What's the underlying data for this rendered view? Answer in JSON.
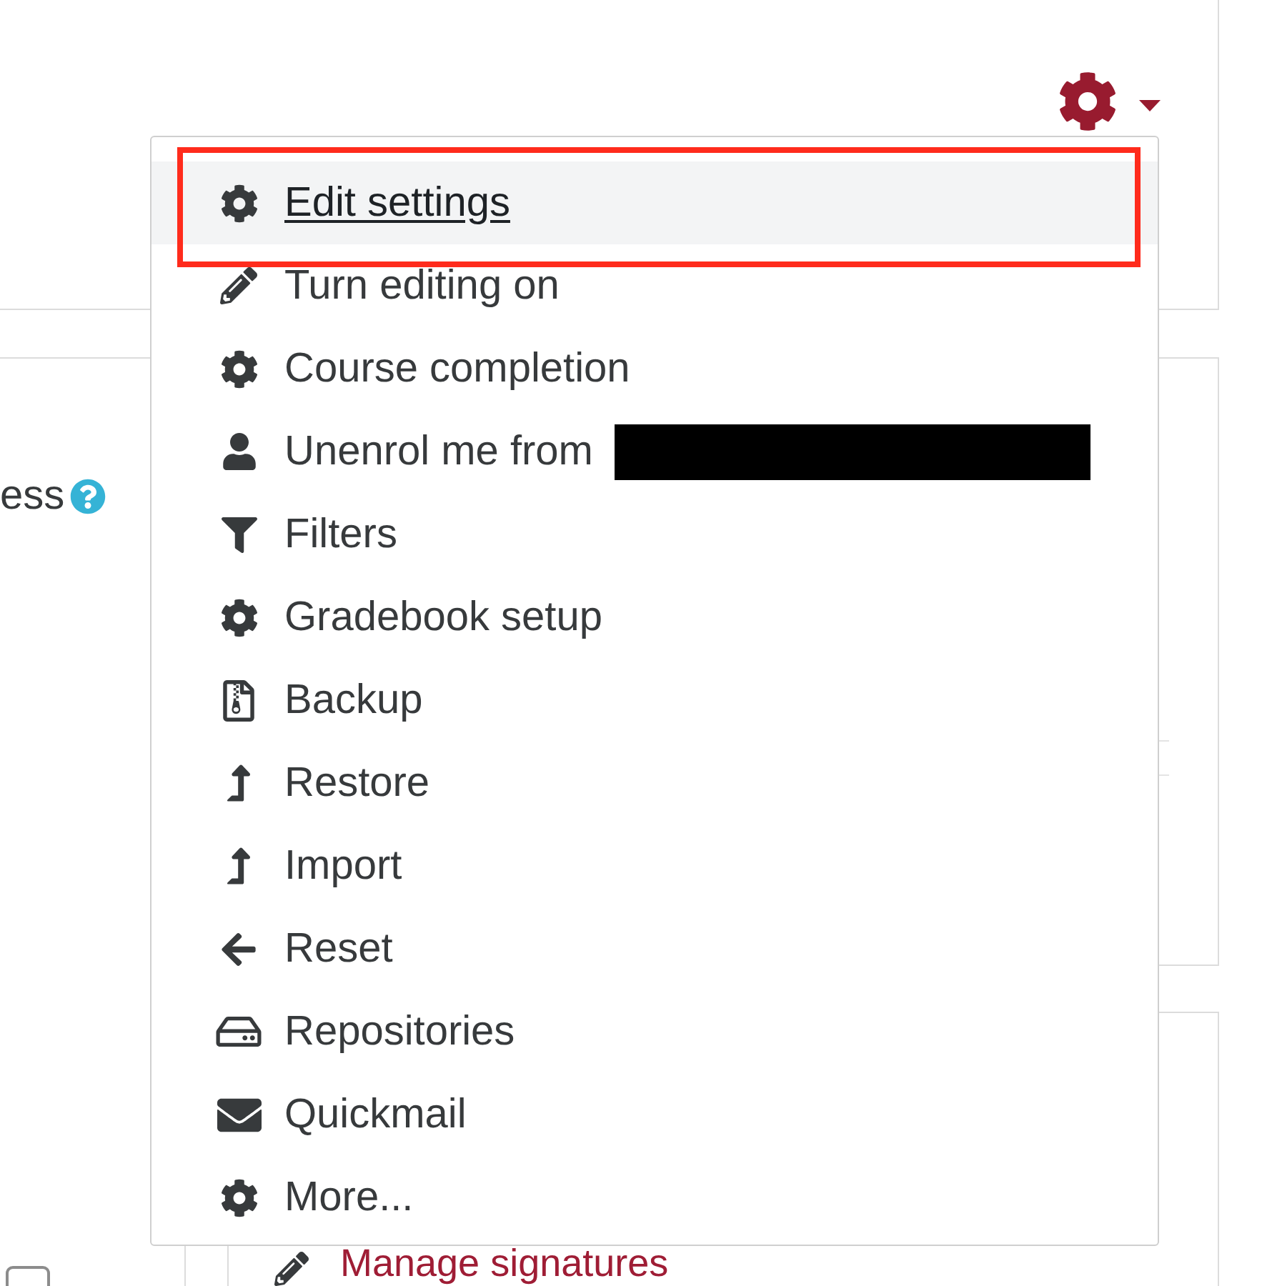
{
  "settings_menu": {
    "expanded": true,
    "items": [
      {
        "label": "Edit settings",
        "selected": true,
        "outlined": true,
        "redacted": false
      },
      {
        "label": "Turn editing on",
        "selected": false,
        "outlined": false,
        "redacted": false
      },
      {
        "label": "Course completion",
        "selected": false,
        "outlined": false,
        "redacted": false
      },
      {
        "label": "Unenrol me from",
        "selected": false,
        "outlined": false,
        "redacted": true
      },
      {
        "label": "Filters",
        "selected": false,
        "outlined": false,
        "redacted": false
      },
      {
        "label": "Gradebook setup",
        "selected": false,
        "outlined": false,
        "redacted": false
      },
      {
        "label": "Backup",
        "selected": false,
        "outlined": false,
        "redacted": false
      },
      {
        "label": "Restore",
        "selected": false,
        "outlined": false,
        "redacted": false
      },
      {
        "label": "Import",
        "selected": false,
        "outlined": false,
        "redacted": false
      },
      {
        "label": "Reset",
        "selected": false,
        "outlined": false,
        "redacted": false
      },
      {
        "label": "Repositories",
        "selected": false,
        "outlined": false,
        "redacted": false
      },
      {
        "label": "Quickmail",
        "selected": false,
        "outlined": false,
        "redacted": false
      },
      {
        "label": "More...",
        "selected": false,
        "outlined": false,
        "redacted": false
      }
    ]
  },
  "side_panel": {
    "label": "ess",
    "checkbox": {
      "checked": false
    }
  },
  "signatures_block": {
    "link": "Manage signatures"
  }
}
